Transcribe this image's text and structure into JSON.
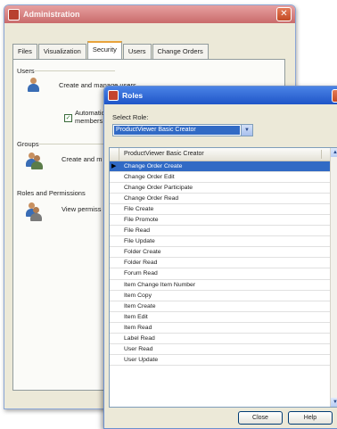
{
  "admin_window": {
    "title": "Administration",
    "tabs": [
      "Files",
      "Visualization",
      "Security",
      "Users",
      "Change Orders"
    ],
    "active_tab": "Security",
    "sections": {
      "users": {
        "heading": "Users",
        "description": "Create and manage users",
        "checkbox_label_line1": "Automatic",
        "checkbox_label_line2": "members"
      },
      "groups": {
        "heading": "Groups",
        "description": "Create and m"
      },
      "roles": {
        "heading": "Roles and Permissions",
        "description": "View permiss"
      }
    }
  },
  "roles_window": {
    "title": "Roles",
    "select_label": "Select Role:",
    "selected_role": "ProductViewer Basic Creator",
    "grid_header": "ProductViewer Basic Creator",
    "permissions": [
      "Change Order Create",
      "Change Order Edit",
      "Change Order Participate",
      "Change Order Read",
      "File Create",
      "File Promote",
      "File Read",
      "File Update",
      "Folder Create",
      "Folder Read",
      "Forum Read",
      "Item Change Item Number",
      "Item Copy",
      "Item Create",
      "Item Edit",
      "Item Read",
      "Label Read",
      "User Read",
      "User Update"
    ],
    "selected_index": 0,
    "buttons": {
      "close": "Close",
      "help": "Help"
    }
  }
}
